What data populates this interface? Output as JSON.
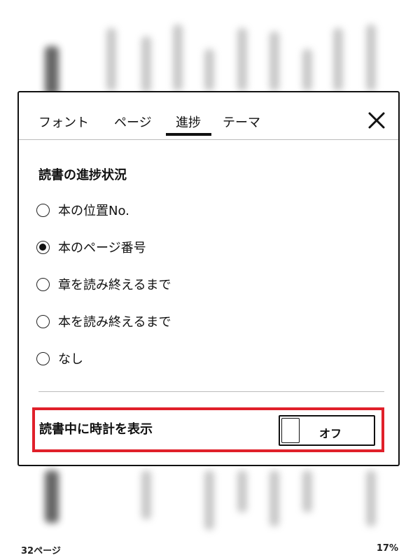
{
  "tabs": [
    {
      "label": "フォント"
    },
    {
      "label": "ページ"
    },
    {
      "label": "進捗"
    },
    {
      "label": "テーマ"
    }
  ],
  "active_tab": "進捗",
  "section": {
    "title": "読書の進捗状況",
    "options": [
      {
        "label": "本の位置No.",
        "selected": false
      },
      {
        "label": "本のページ番号",
        "selected": true
      },
      {
        "label": "章を読み終えるまで",
        "selected": false
      },
      {
        "label": "本を読み終えるまで",
        "selected": false
      },
      {
        "label": "なし",
        "selected": false
      }
    ]
  },
  "clock_setting": {
    "label": "読書中に時計を表示",
    "toggle_state": "オフ"
  },
  "footer": {
    "page": "32ページ",
    "percent": "17%"
  },
  "icons": {
    "close": "close-icon"
  },
  "colors": {
    "highlight": "#e0202a"
  }
}
